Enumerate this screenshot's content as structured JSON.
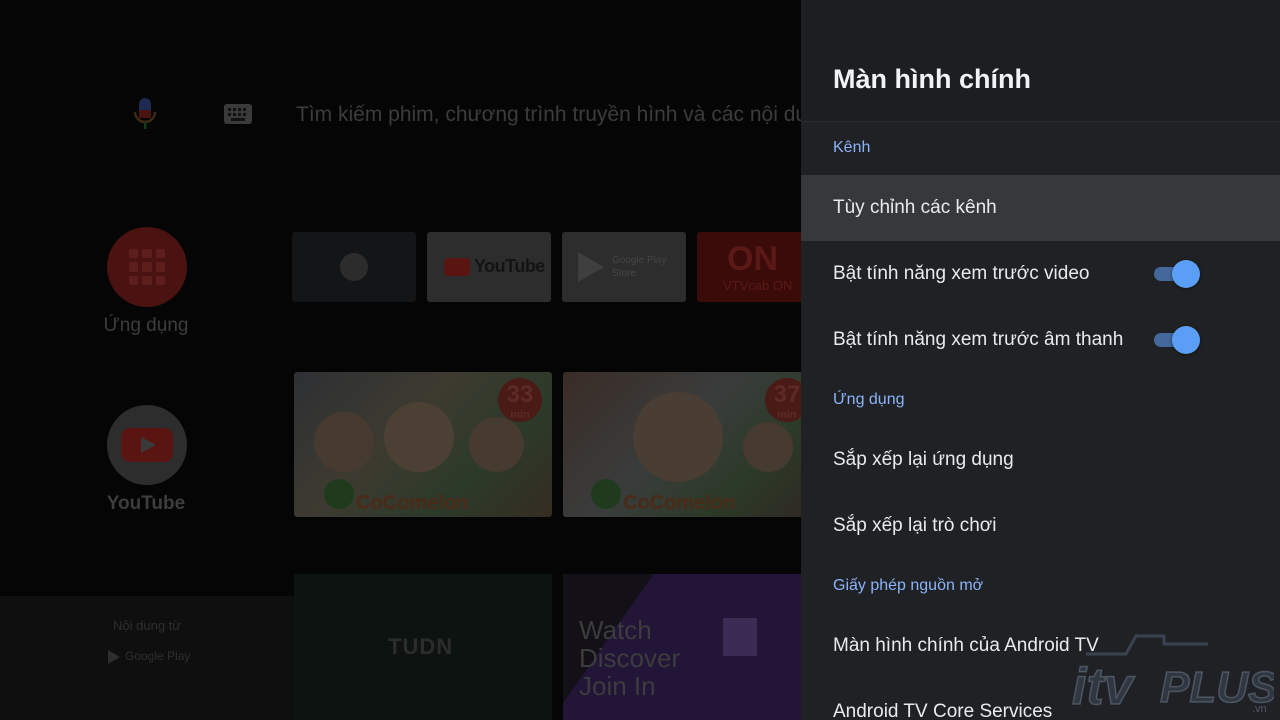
{
  "home": {
    "search_placeholder": "Tìm kiếm phim, chương trình truyền hình và các nội du",
    "apps_label": "Ứng dụng",
    "youtube_label": "YouTube",
    "tiles": [
      {
        "name": "apps-grid-tile"
      },
      {
        "name": "YouTube",
        "text": "YouTube"
      },
      {
        "name": "Google Play Store",
        "text": "Google Play Store"
      },
      {
        "name": "VTVcab ON",
        "logo": "ON",
        "text": "VTVcab ON"
      }
    ],
    "thumbnails": [
      {
        "minutes": "33",
        "unit": "min",
        "brand": "CoComelon"
      },
      {
        "minutes": "37",
        "unit": "min",
        "brand": "CoComelon"
      }
    ],
    "content_from_label": "Nội dung từ",
    "content_from_source": "Google Play",
    "cards": [
      {
        "name": "TUDN",
        "text": "TUDN"
      },
      {
        "name": "Twitch",
        "lines": [
          "Watch",
          "Discover",
          "Join In"
        ]
      }
    ]
  },
  "panel": {
    "title": "Màn hình chính",
    "sections": [
      {
        "header": "Kênh"
      },
      {
        "header": "Ứng dụng"
      },
      {
        "header": "Giấy phép nguồn mở"
      }
    ],
    "items": {
      "customize_channels": "Tùy chỉnh các kênh",
      "video_preview": "Bật tính năng xem trước video",
      "audio_preview": "Bật tính năng xem trước âm thanh",
      "reorder_apps": "Sắp xếp lại ứng dụng",
      "reorder_games": "Sắp xếp lại trò chơi",
      "android_tv_home": "Màn hình chính của Android TV",
      "android_tv_core": "Android TV Core Services"
    },
    "toggles": {
      "video_preview": true,
      "audio_preview": true
    },
    "accent_color": "#8ab4f8",
    "toggle_color": "#5a9ff5"
  },
  "watermark": {
    "text": "itv PLUS",
    "suffix": ".vn"
  }
}
